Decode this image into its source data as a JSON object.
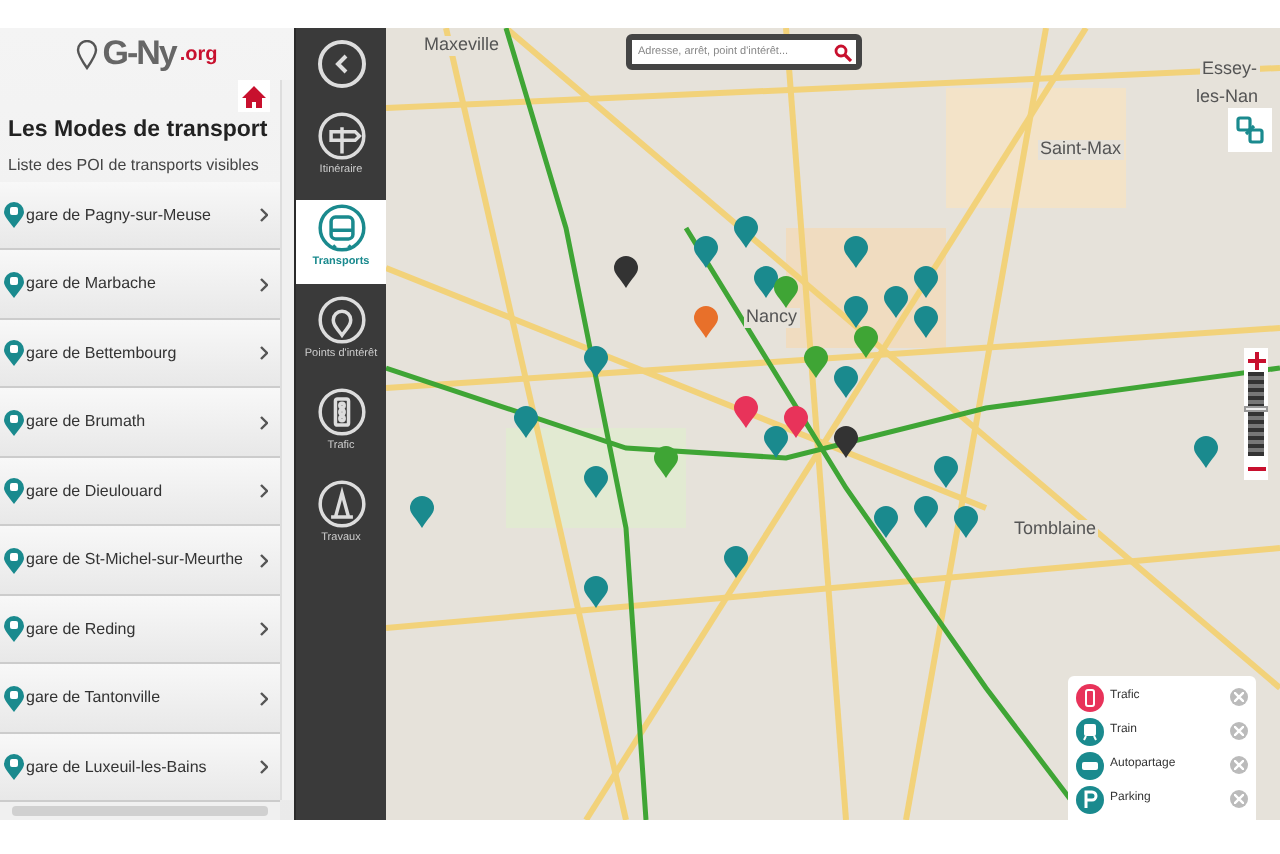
{
  "logo": {
    "text": "G-Ny",
    "suffix": ".org"
  },
  "panel": {
    "title": "Les Modes de transport",
    "subtitle": "Liste des POI de transports visibles"
  },
  "stations": [
    {
      "label": "gare de Pagny-sur-Meuse"
    },
    {
      "label": "gare de Marbache"
    },
    {
      "label": "gare de Bettembourg"
    },
    {
      "label": "gare de Brumath"
    },
    {
      "label": "gare de Dieulouard"
    },
    {
      "label": "gare de St-Michel-sur-Meurthe"
    },
    {
      "label": "gare de Reding"
    },
    {
      "label": "gare de Tantonville"
    },
    {
      "label": "gare de Luxeuil-les-Bains"
    }
  ],
  "nav": [
    {
      "kind": "signpost",
      "label": "Itinéraire",
      "selected": false
    },
    {
      "kind": "tram",
      "label": "Transports",
      "selected": true
    },
    {
      "kind": "pin",
      "label": "Points d'intérêt",
      "selected": false
    },
    {
      "kind": "light",
      "label": "Trafic",
      "selected": false
    },
    {
      "kind": "cone",
      "label": "Travaux",
      "selected": false
    }
  ],
  "search": {
    "placeholder": "Adresse, arrêt, point d'intérêt..."
  },
  "map_labels": [
    {
      "text": "Maxeville"
    },
    {
      "text": "Essey-"
    },
    {
      "text": "les-Nan"
    },
    {
      "text": "Saint-Max"
    },
    {
      "text": "Nancy"
    },
    {
      "text": "Tomblaine"
    }
  ],
  "zoom": {
    "level": 0.55
  },
  "legend": [
    {
      "kind": "light",
      "label": "Trafic",
      "color": "#e8335a"
    },
    {
      "kind": "train",
      "label": "Train",
      "color": "#1a8a8e"
    },
    {
      "kind": "car",
      "label": "Autopartage",
      "color": "#1a8a8e"
    },
    {
      "kind": "parking",
      "label": "Parking",
      "color": "#1a8a8e"
    }
  ]
}
